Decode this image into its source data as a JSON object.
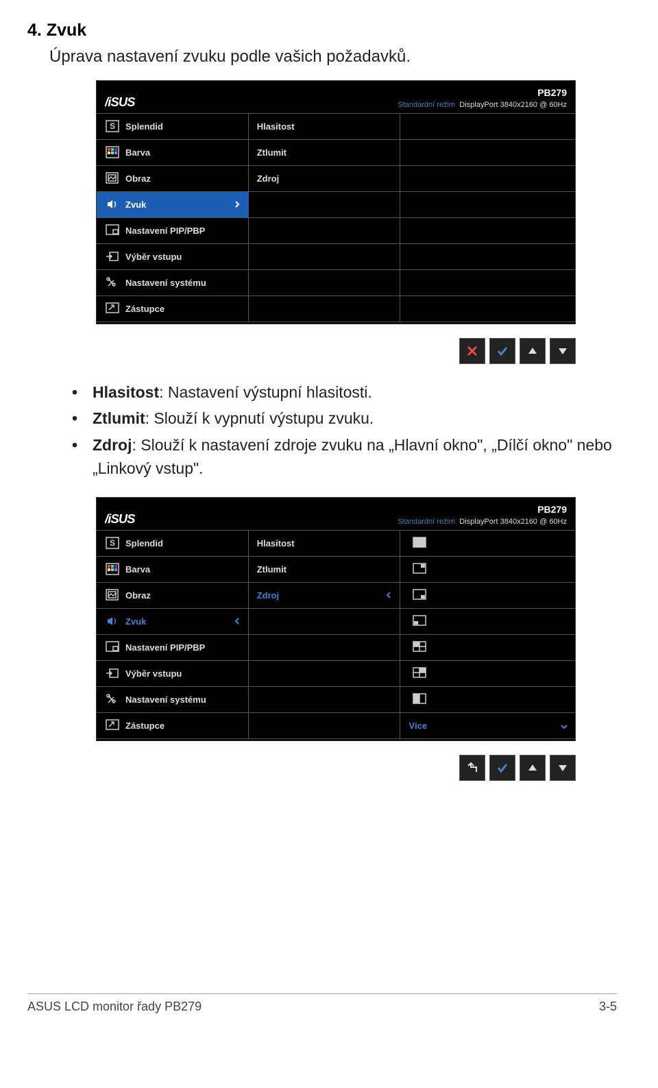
{
  "heading": "4.  Zvuk",
  "subheading": "Úprava nastavení zvuku podle vašich požadavků.",
  "osd": {
    "model": "PB279",
    "mode_label": "Standardní režim",
    "resolution": "DisplayPort 3840x2160 @ 60Hz",
    "col1": {
      "splendid": "Splendid",
      "barva": "Barva",
      "obraz": "Obraz",
      "zvuk": "Zvuk",
      "pip": "Nastavení PIP/PBP",
      "vstup": "Výběr vstupu",
      "system": "Nastavení systému",
      "zastupce": "Zástupce"
    },
    "col2": {
      "hlasitost": "Hlasitost",
      "ztlumit": "Ztlumit",
      "zdroj": "Zdroj"
    },
    "col3": {
      "vice": "Více"
    }
  },
  "bullets": {
    "b1_bold": "Hlasitost",
    "b1_rest": ": Nastavení výstupní hlasitosti.",
    "b2_bold": "Ztlumit",
    "b2_rest": ": Slouží k vypnutí výstupu zvuku.",
    "b3_bold": "Zdroj",
    "b3_rest": ": Slouží k nastavení zdroje zvuku na „Hlavní okno\", „Dílčí okno\" nebo „Linkový vstup\"."
  },
  "footer": {
    "left": "ASUS LCD monitor řady PB279",
    "right": "3-5"
  }
}
